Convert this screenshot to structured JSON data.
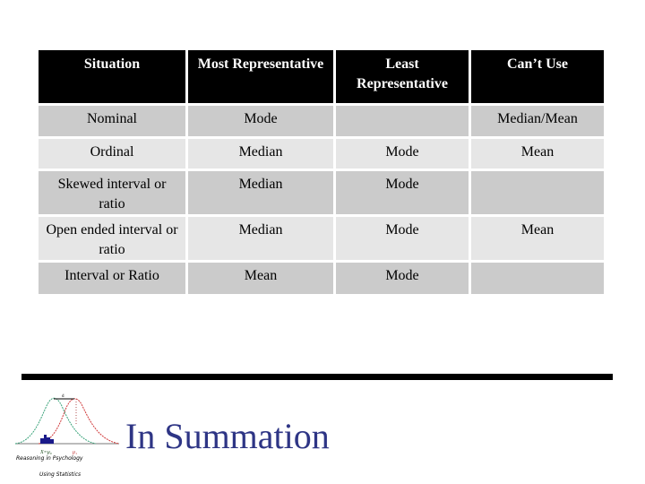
{
  "table": {
    "headers": [
      "Situation",
      "Most Representative",
      "Least Representative",
      "Can’t Use"
    ],
    "rows": [
      [
        "Nominal",
        "Mode",
        "",
        "Median/Mean"
      ],
      [
        "Ordinal",
        "Median",
        "Mode",
        "Mean"
      ],
      [
        "Skewed interval or ratio",
        "Median",
        "Mode",
        ""
      ],
      [
        "Open ended interval or ratio",
        "Median",
        "Mode",
        "Mean"
      ],
      [
        "Interval or Ratio",
        "Mean",
        "Mode",
        ""
      ]
    ]
  },
  "logo": {
    "icon": "normal-distribution-curves-icon",
    "label_sample": "X=μ₀",
    "label_mu": "μ₁",
    "caption_line1": "Reasoning in Psychology",
    "caption_line2": "Using Statistics",
    "colors": {
      "curve_left": "#3aa37a",
      "curve_right": "#d0393a",
      "histogram": "#1a1a8a"
    }
  },
  "slide": {
    "title": "In Summation",
    "title_color": "#2e3585"
  }
}
